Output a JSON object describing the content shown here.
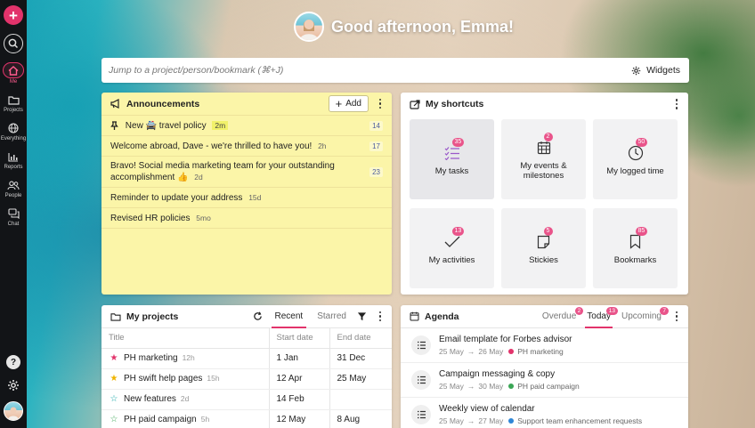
{
  "rail": {
    "nav": [
      {
        "label": "Me",
        "icon": "home-icon",
        "active": true
      },
      {
        "label": "Projects",
        "icon": "folder-icon"
      },
      {
        "label": "Everything",
        "icon": "globe-icon"
      },
      {
        "label": "Reports",
        "icon": "bar-chart-icon"
      },
      {
        "label": "People",
        "icon": "people-icon"
      },
      {
        "label": "Chat",
        "icon": "chat-icon"
      }
    ],
    "help_label": "?"
  },
  "greeting": "Good afternoon, Emma!",
  "jump": {
    "placeholder": "Jump to a project/person/bookmark (⌘+J)",
    "widgets_label": "Widgets"
  },
  "announcements": {
    "title": "Announcements",
    "add_label": "Add",
    "items": [
      {
        "text": "New 🚔 travel policy",
        "age": "2m",
        "count": "14",
        "pinned": true
      },
      {
        "text": "Welcome abroad, Dave - we're thrilled to have you!",
        "age": "2h",
        "count": "17"
      },
      {
        "text": "Bravo! Social media marketing team for your outstanding accomplishment 👍",
        "age": "2d",
        "count": "23"
      },
      {
        "text": "Reminder to update your address",
        "age": "15d",
        "count": ""
      },
      {
        "text": "Revised HR policies",
        "age": "5mo",
        "count": ""
      }
    ]
  },
  "shortcuts": {
    "title": "My shortcuts",
    "tiles": [
      {
        "label": "My tasks",
        "badge": "35",
        "icon": "tasks-icon"
      },
      {
        "label": "My events & milestones",
        "badge": "2",
        "icon": "calendar-icon"
      },
      {
        "label": "My logged time",
        "badge": "50",
        "icon": "clock-icon"
      },
      {
        "label": "My activities",
        "badge": "13",
        "icon": "checkmark-icon"
      },
      {
        "label": "Stickies",
        "badge": "5",
        "icon": "sticky-note-icon"
      },
      {
        "label": "Bookmarks",
        "badge": "85",
        "icon": "bookmark-icon"
      }
    ]
  },
  "projects": {
    "title": "My projects",
    "tabs": [
      "Recent",
      "Starred"
    ],
    "columns": [
      "Title",
      "Start date",
      "End date"
    ],
    "rows": [
      {
        "title": "PH marketing",
        "age": "12h",
        "start": "1 Jan",
        "end": "31 Dec",
        "star": "#e2336b",
        "filled": true
      },
      {
        "title": "PH swift help pages",
        "age": "15h",
        "start": "12 Apr",
        "end": "25 May",
        "star": "#f0b400",
        "filled": true
      },
      {
        "title": "New features",
        "age": "2d",
        "start": "14 Feb",
        "end": "",
        "star": "#18a7a7",
        "filled": false
      },
      {
        "title": "PH paid campaign",
        "age": "5h",
        "start": "12 May",
        "end": "8 Aug",
        "star": "#3aa655",
        "filled": false
      }
    ]
  },
  "agenda": {
    "title": "Agenda",
    "tabs": [
      {
        "label": "Overdue",
        "badge": "2"
      },
      {
        "label": "Today",
        "badge": "13",
        "active": true
      },
      {
        "label": "Upcoming",
        "badge": "7"
      }
    ],
    "items": [
      {
        "title": "Email template for Forbes advisor",
        "from": "25 May",
        "to": "26 May",
        "project": "PH marketing",
        "color": "#e2336b"
      },
      {
        "title": "Campaign messaging & copy",
        "from": "25 May",
        "to": "30 May",
        "project": "PH paid campaign",
        "color": "#3aa655"
      },
      {
        "title": "Weekly view of calendar",
        "from": "25 May",
        "to": "27 May",
        "project": "Support team enhancement requests",
        "color": "#2f86d6"
      }
    ]
  },
  "colors": {
    "accent": "#e2336b",
    "announcement_bg": "#fbf5a8",
    "rail_bg": "#121417"
  }
}
